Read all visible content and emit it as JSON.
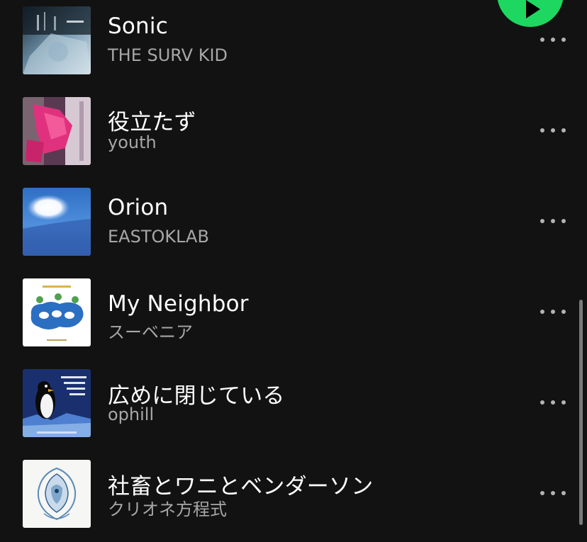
{
  "colors": {
    "background": "#121212",
    "title": "#ffffff",
    "artist": "#a7a7a7",
    "accent": "#1ed760",
    "more_dots": "#b3b3b3"
  },
  "tracks": [
    {
      "title": "Sonic",
      "artist": "THE SURV KID",
      "cover_icon": "album-cover-sonic"
    },
    {
      "title": "役立たず",
      "artist": "youth",
      "cover_icon": "album-cover-youth"
    },
    {
      "title": "Orion",
      "artist": "EASTOKLAB",
      "cover_icon": "album-cover-orion"
    },
    {
      "title": "My Neighbor",
      "artist": "スーベニア",
      "cover_icon": "album-cover-my-neighbor"
    },
    {
      "title": "広めに閉じている",
      "artist": "ophill",
      "cover_icon": "album-cover-ophill"
    },
    {
      "title": "社畜とワニとベンダーソン",
      "artist": "クリオネ方程式",
      "cover_icon": "album-cover-clione"
    }
  ],
  "icons": {
    "play": "play-icon",
    "more": "more-horizontal-icon"
  }
}
